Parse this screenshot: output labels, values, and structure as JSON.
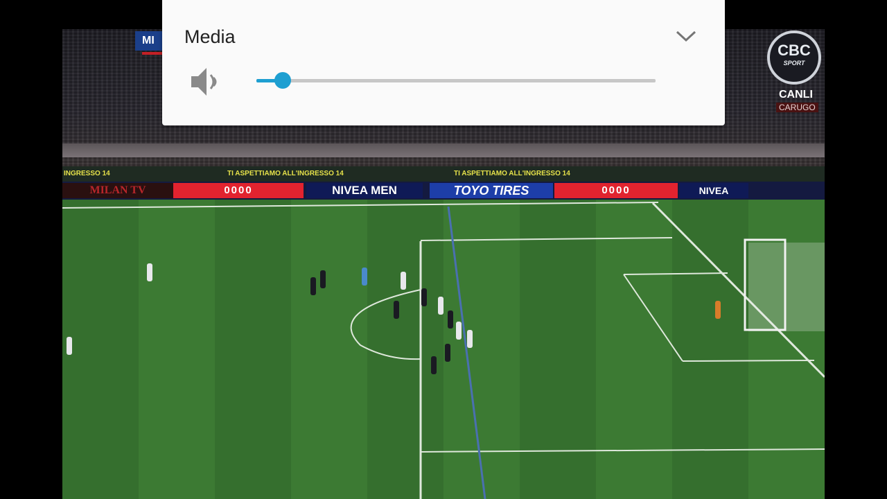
{
  "volume_panel": {
    "title": "Media",
    "level": 0.066,
    "accent_color": "#1e9fd1",
    "speaker_icon": "volume-low-icon",
    "collapse_icon": "chevron-down-icon"
  },
  "video": {
    "score_tag": "MI",
    "channel_logo": {
      "name": "CBC",
      "sub": "SPORT"
    },
    "live_label": "CANLI",
    "venue_label": "CARUGO",
    "banners": {
      "top_left": "INGRESSO 14",
      "top_center": "TI ASPETTIAMO ALL'INGRESSO 14",
      "top_right": "TI ASPETTIAMO ALL'INGRESSO 14",
      "milan_tv": "MILAN TV",
      "audi": "0000",
      "nivea": "NIVEA MEN",
      "toyo": "TOYO TIRES",
      "nivea_right": "NIVEA"
    }
  }
}
